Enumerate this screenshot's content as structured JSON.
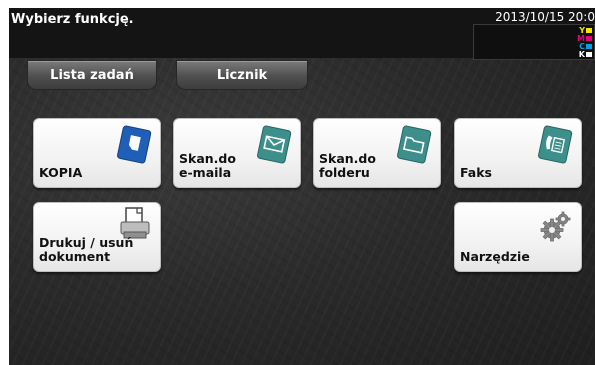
{
  "header": {
    "title": "Wybierz funkcję.",
    "datetime": "2013/10/15 20:0",
    "toner": [
      {
        "letter": "Y",
        "color": "#f2e600"
      },
      {
        "letter": "M",
        "color": "#e0007a"
      },
      {
        "letter": "C",
        "color": "#00a0e0"
      },
      {
        "letter": "K",
        "color": "#111111"
      }
    ]
  },
  "tabs": {
    "job_list": "Lista zadań",
    "counter": "Licznik"
  },
  "tiles": {
    "copy": {
      "label": "KOPIA",
      "icon": "copy-icon",
      "color": "#1f5fb8"
    },
    "scan_email": {
      "label": "Skan.do\ne-maila",
      "icon": "email-icon",
      "color": "#3c8f8a"
    },
    "scan_folder": {
      "label": "Skan.do\nfolderu",
      "icon": "folder-icon",
      "color": "#3c8f8a"
    },
    "fax": {
      "label": "Faks",
      "icon": "fax-icon",
      "color": "#3c8f8a"
    },
    "print_delete": {
      "label": "Drukuj / usuń\ndokument",
      "icon": "document-print-icon",
      "color": "#555555"
    },
    "utility": {
      "label": "Narzędzie",
      "icon": "gear-icon",
      "color": "#8a8a8a"
    }
  }
}
